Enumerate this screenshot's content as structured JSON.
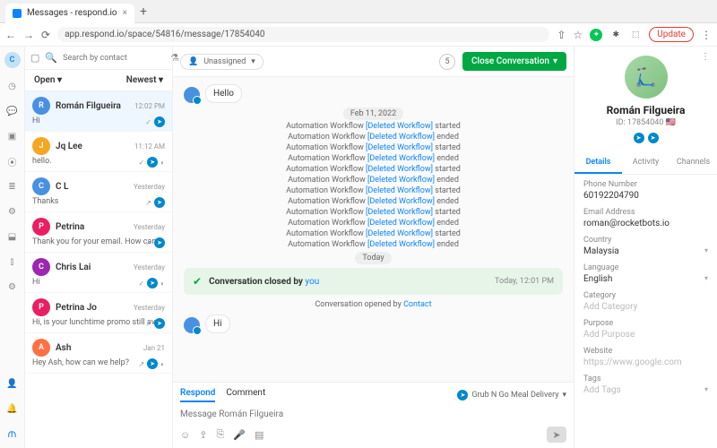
{
  "browser": {
    "tab_title": "Messages - respond.io",
    "url": "app.respond.io/space/54816/message/17854040",
    "update_label": "Update"
  },
  "rail": {
    "user_initial": "C"
  },
  "convo_list": {
    "search_placeholder": "Search by contact",
    "open_label": "Open",
    "newest_label": "Newest",
    "items": [
      {
        "name": "Román Filgueira",
        "time": "12:02 PM",
        "preview": "Hi",
        "avatar_bg": "#4a90e2",
        "selected": true,
        "checks": true
      },
      {
        "name": "Jq Lee",
        "time": "11:12 AM",
        "preview": "hello.",
        "avatar_bg": "#f5a623",
        "checks": true,
        "extra": true
      },
      {
        "name": "C L",
        "time": "Yesterday",
        "preview": "Thanks",
        "avatar_bg": "#4a90e2",
        "st": true
      },
      {
        "name": "Petrina",
        "time": "Yesterday",
        "preview": "Thank you for your email. How can we help you?",
        "avatar_bg": "#e91e63",
        "st": true
      },
      {
        "name": "Chris Lai",
        "time": "Yesterday",
        "preview": "Hi",
        "avatar_bg": "#9c27b0",
        "checks": true,
        "extra": true
      },
      {
        "name": "Petrina Jo",
        "time": "Yesterday",
        "preview": "Hi, is your lunchtime promo still available?",
        "avatar_bg": "#e91e63",
        "st": true
      },
      {
        "name": "Ash",
        "time": "Jan 21",
        "preview": "Hey Ash, how can we help?",
        "avatar_bg": "#ff7043",
        "st": true,
        "extra": true
      }
    ]
  },
  "main": {
    "unassigned_label": "Unassigned",
    "step": "5",
    "close_label": "Close Conversation",
    "hello_msg": "Hello",
    "date_1": "Feb 11, 2022",
    "workflow_prefix": "Automation Workflow ",
    "workflow_link": "[Deleted Workflow]",
    "logs": [
      " started",
      " ended",
      " started",
      " ended",
      " started",
      " ended",
      " started",
      " ended",
      " started",
      " ended",
      " started",
      " ended"
    ],
    "today_label": "Today",
    "closed_text": "Conversation closed by ",
    "closed_you": "you",
    "closed_time": "Today, 12:01 PM",
    "opened_text": "Conversation opened by ",
    "opened_link": "Contact",
    "hi_msg": "Hi",
    "respond_tab": "Respond",
    "comment_tab": "Comment",
    "channel_label": "Grub N Go Meal Delivery",
    "composer_placeholder": "Message Román Filgueira"
  },
  "profile": {
    "name": "Román Filgueira",
    "id_label": "ID: 17854040",
    "tabs": {
      "details": "Details",
      "activity": "Activity",
      "channels": "Channels"
    },
    "fields": {
      "phone_l": "Phone Number",
      "phone_v": "60192204790",
      "email_l": "Email Address",
      "email_v": "roman@rocketbots.io",
      "country_l": "Country",
      "country_v": "Malaysia",
      "lang_l": "Language",
      "lang_v": "English",
      "cat_l": "Category",
      "cat_v": "Add Category",
      "purpose_l": "Purpose",
      "purpose_v": "Add Purpose",
      "web_l": "Website",
      "web_v": "https://www.google.com",
      "tags_l": "Tags",
      "tags_v": "Add Tags"
    }
  }
}
